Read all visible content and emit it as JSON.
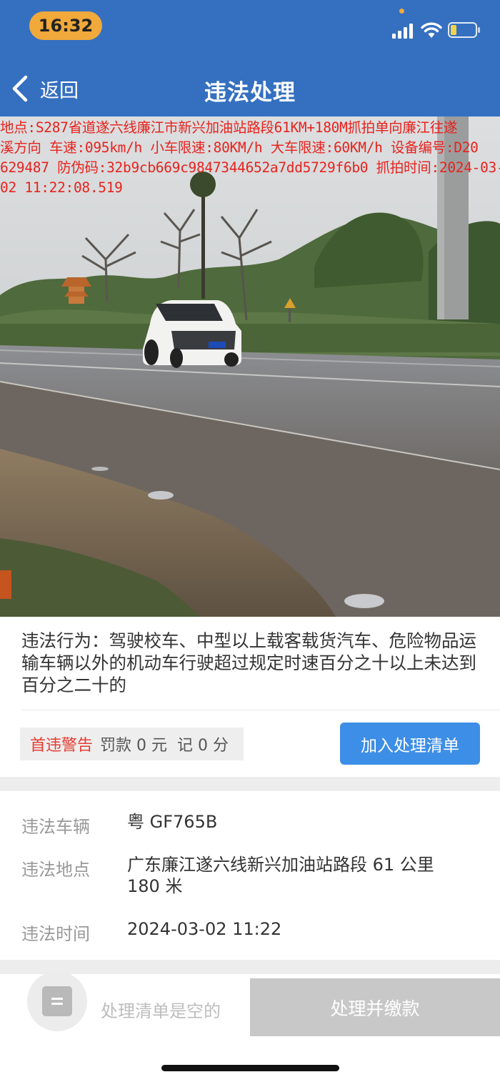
{
  "status_bar": {
    "time": "16:32"
  },
  "nav": {
    "back_label": "返回",
    "title": "违法处理"
  },
  "photo": {
    "overlay_lines": [
      "地点:S287省道遂六线廉江市新兴加油站路段61KM+180M抓拍单向廉江往遂",
      "溪方向 车速:095km/h 小车限速:80KM/h 大车限速:60KM/h 设备编号:D20",
      "629487 防伪码:32b9cb669c9847344652a7dd5729f6b0 抓拍时间:2024-03-",
      "02 11:22:08.519"
    ]
  },
  "violation": {
    "behavior": "违法行为：驾驶校车、中型以上载客载货汽车、危险物品运输车辆以外的机动车行驶超过规定时速百分之十以上未达到百分之二十的",
    "first_offense": "首违警告",
    "fine": "罚款 0 元",
    "points": "记 0 分",
    "add_button": "加入处理清单"
  },
  "details": {
    "vehicle_label": "违法车辆",
    "vehicle_value": "粤 GF765B",
    "location_label": "违法地点",
    "location_value": "广东廉江遂六线新兴加油站路段 61 公里 180 米",
    "time_label": "违法时间",
    "time_value": "2024-03-02 11:22"
  },
  "bottom": {
    "empty_text": "处理清单是空的",
    "pay_button": "处理并缴款"
  },
  "colors": {
    "header_blue": "#3570c0",
    "button_blue": "#3d8ee6",
    "warning_red": "#e43d33",
    "overlay_red": "#e8231d",
    "disabled_gray": "#c8c8c8"
  }
}
